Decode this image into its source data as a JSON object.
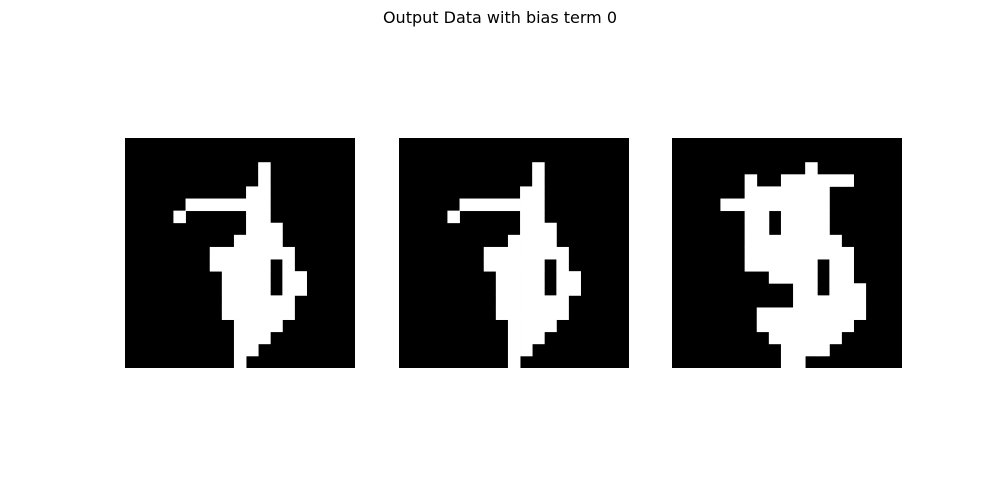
{
  "figure": {
    "title": "Output Data with bias term 0"
  },
  "chart_data": {
    "type": "heatmap",
    "title": "Output Data with bias term 0",
    "colormap": {
      "on": "#ffffff",
      "off": "#000000"
    },
    "grid_size": [
      19,
      19
    ],
    "images": [
      {
        "rows": [
          "0000000000000000000",
          "0000000000000000000",
          "0000000000010000000",
          "0000000000010000000",
          "0000000000110000000",
          "0000011111110000000",
          "0000100000110000000",
          "0000000000111000000",
          "0000000001111000000",
          "0000000111111100000",
          "0000000111110100000",
          "0000000011110110000",
          "0000000011110110000",
          "0000000011111100000",
          "0000000011111100000",
          "0000000001111000000",
          "0000000001110000000",
          "0000000001100000000",
          "0000000001000000000"
        ]
      },
      {
        "rows": [
          "0000000000000000000",
          "0000000000000000000",
          "0000000000010000000",
          "0000000000010000000",
          "0000000000110000000",
          "0000011111110000000",
          "0000100000110000000",
          "0000000000111000000",
          "0000000001111000000",
          "0000000111111100000",
          "0000000111110100000",
          "0000000011110110000",
          "0000000011110110000",
          "0000000011111100000",
          "0000000011111100000",
          "0000000001111000000",
          "0000000001110000000",
          "0000000001100000000",
          "0000000001000000000"
        ]
      },
      {
        "rows": [
          "0000000000000000000",
          "0000000000000000000",
          "0000000000010000000",
          "0000001001111110000",
          "0000001111111000000",
          "0000111111111000000",
          "0000001101111000000",
          "0000001101111000000",
          "0000001111111100000",
          "0000001111111110000",
          "0000001111110110000",
          "0000000011110110000",
          "0000000000110111000",
          "0000000000111111000",
          "0000000111111111000",
          "0000000111111110000",
          "0000000011111100000",
          "0000000001111000000",
          "0000000001100000000"
        ]
      }
    ]
  }
}
